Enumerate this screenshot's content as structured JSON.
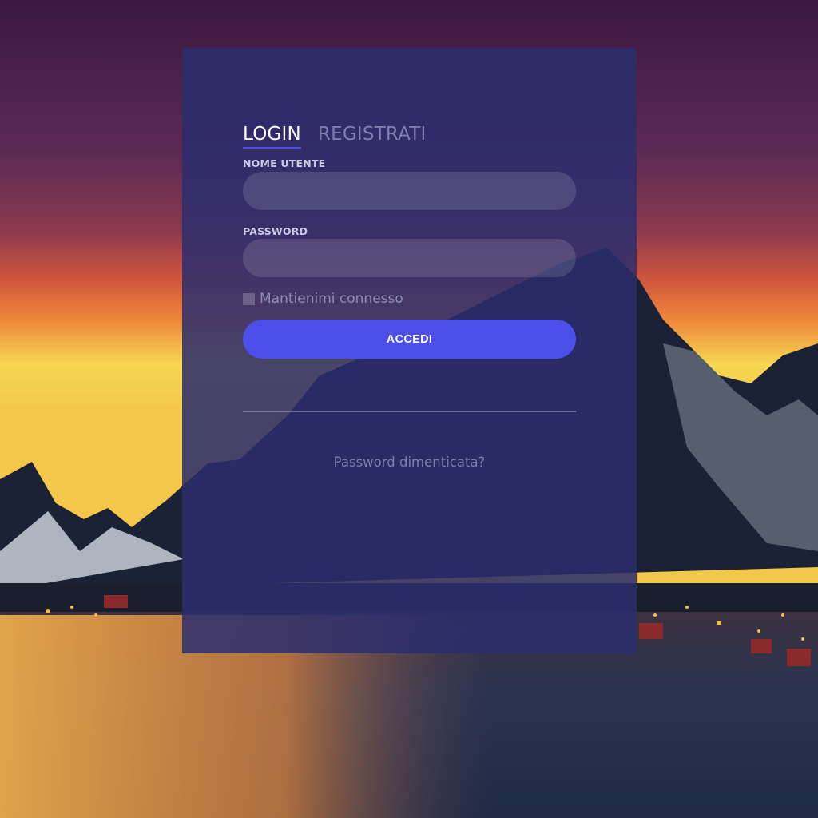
{
  "tabs": {
    "login": "LOGIN",
    "register": "REGISTRATI"
  },
  "form": {
    "username_label": "NOME UTENTE",
    "username_value": "",
    "password_label": "PASSWORD",
    "password_value": "",
    "remember_label": "Mantienimi connesso",
    "remember_checked": false,
    "submit_label": "ACCEDI",
    "forgot_label": "Password dimenticata?"
  },
  "colors": {
    "accent": "#4B4EE8",
    "panel": "#2B2D6E",
    "inactive_text": "#7E7FAE"
  },
  "background": {
    "description_icon": "mountain-lake-sunset-photo"
  }
}
